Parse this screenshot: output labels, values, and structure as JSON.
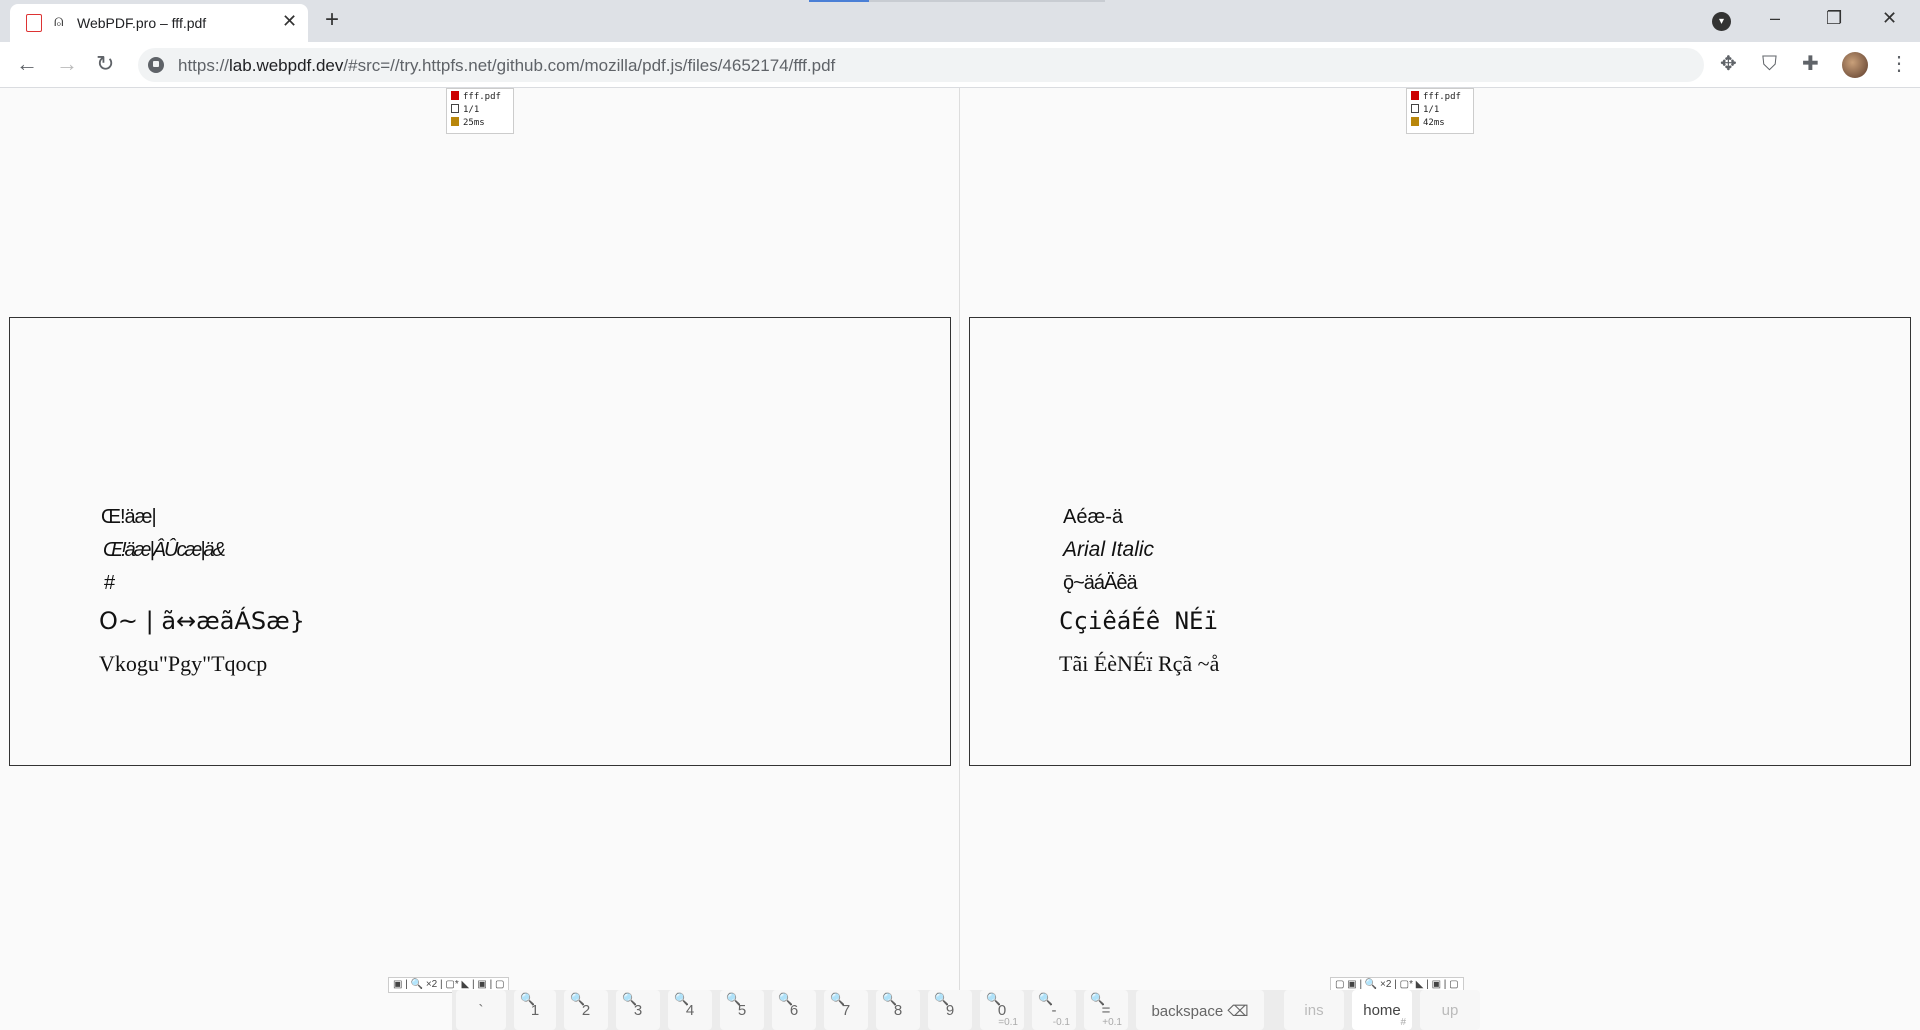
{
  "tab": {
    "title": "WebPDF.pro – fff.pdf",
    "close": "✕",
    "new_tab": "+"
  },
  "window": {
    "minimize": "–",
    "maximize": "❐",
    "close": "✕",
    "dropdown": "▾"
  },
  "nav": {
    "back": "←",
    "forward": "→",
    "reload": "↻"
  },
  "omnibox": {
    "scheme": "https://",
    "host": "lab.webpdf.dev",
    "path": "/#src=//try.httpfs.net/github.com/mozilla/pdf.js/files/4652174/fff.pdf"
  },
  "extensions": [
    "move-icon",
    "shield-icon",
    "puzzle-icon"
  ],
  "menu": "⋮",
  "left_panel": {
    "info": {
      "file": "fff.pdf",
      "pages": "1/1",
      "time": "25ms"
    },
    "lines": [
      "Œ!äæ|",
      "Œ!äæ|ÂÛcæ|ä&",
      "#",
      "O~ | ã↔æãÁSæ}",
      "Vkogu\"Pgy\"Tqocp"
    ],
    "toolbar": "▣ | 🔍 ×2 | ▢* ◣ | ▣ | ▢"
  },
  "right_panel": {
    "info": {
      "file": "fff.pdf",
      "pages": "1/1",
      "time": "42ms"
    },
    "lines": [
      "Aéæ-ä",
      "Arial Italic",
      "ǭ~äáÄêä",
      "CçiêáÉê NÉï",
      "Tãi ÉèNÉï Rçã ~å"
    ],
    "toolbar": "▢ ▣ | 🔍 ×2 | ▢* ◣ | ▣ | ▢"
  },
  "keys": [
    {
      "label": "`",
      "sub": ""
    },
    {
      "label": "1",
      "sub": ""
    },
    {
      "label": "2",
      "sub": ""
    },
    {
      "label": "3",
      "sub": ""
    },
    {
      "label": "4",
      "sub": ""
    },
    {
      "label": "5",
      "sub": ""
    },
    {
      "label": "6",
      "sub": ""
    },
    {
      "label": "7",
      "sub": ""
    },
    {
      "label": "8",
      "sub": ""
    },
    {
      "label": "9",
      "sub": ""
    },
    {
      "label": "0",
      "sub": "=0.1"
    },
    {
      "label": "-",
      "sub": "-0.1"
    },
    {
      "label": "=",
      "sub": "+0.1"
    },
    {
      "label": "backspace ⌫",
      "sub": ""
    },
    {
      "label": "ins",
      "sub": ""
    },
    {
      "label": "home",
      "sub": "#"
    },
    {
      "label": "up",
      "sub": ""
    }
  ]
}
